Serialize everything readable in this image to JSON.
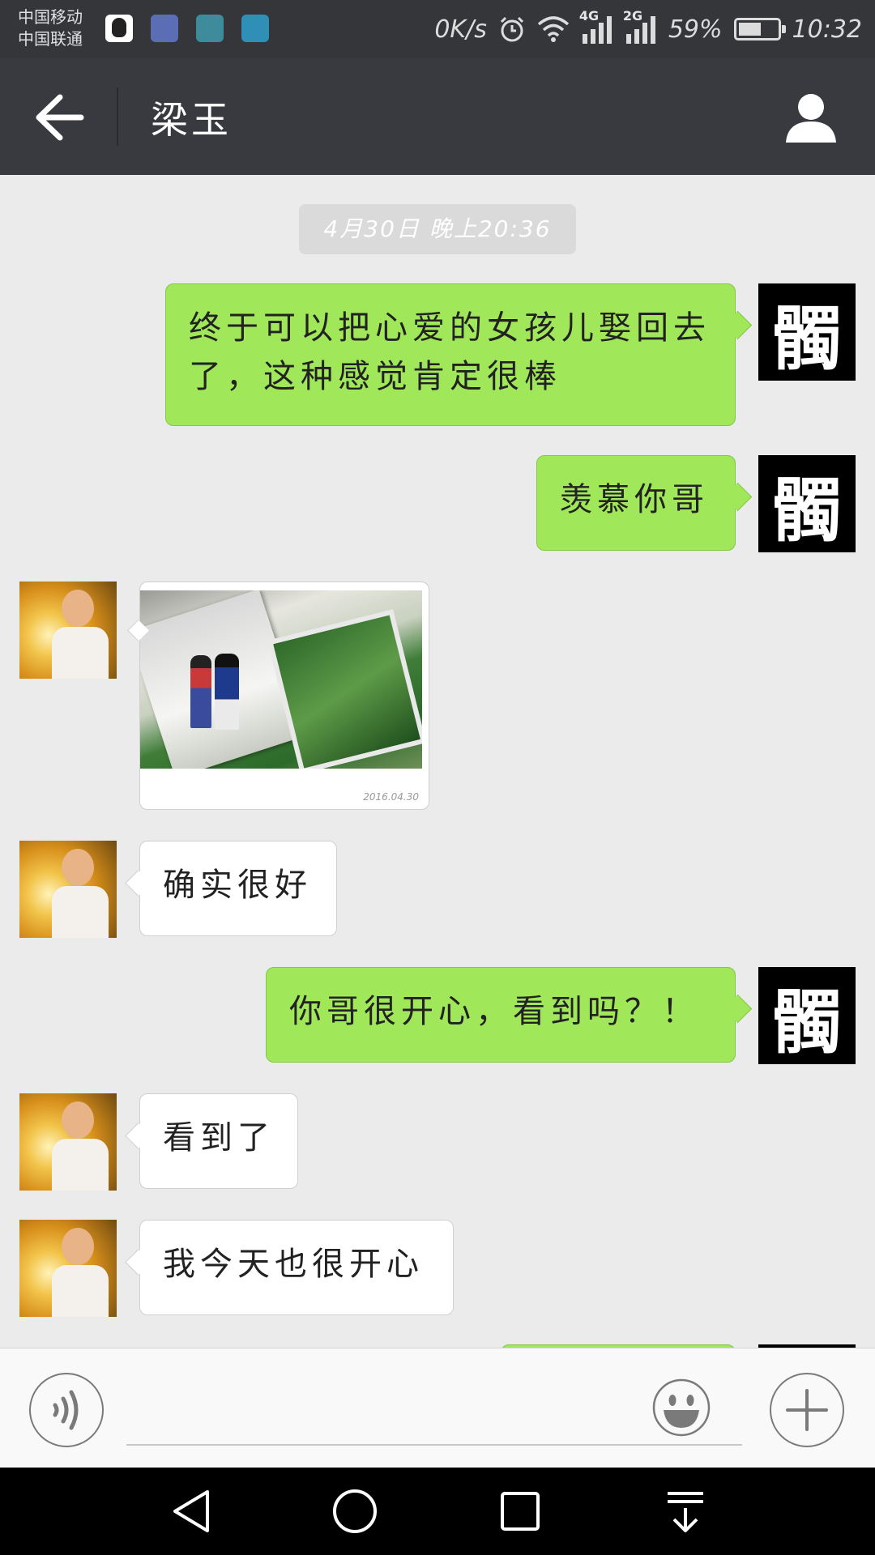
{
  "status_bar": {
    "carrier_1": "中国移动",
    "carrier_2": "中国联通",
    "notification_icons": [
      "qq-icon",
      "health-icon",
      "gallery-icon",
      "message-icon"
    ],
    "network_speed": "0K/s",
    "network_1": "4G",
    "network_2": "2G",
    "battery_percent": "59%",
    "battery_level": 0.59,
    "time": "10:32"
  },
  "header": {
    "title": "梁玉",
    "back_icon": "arrow-left-icon",
    "profile_icon": "person-icon"
  },
  "chat": {
    "timestamp": "4月30日 晚上20:36",
    "my_avatar_char": "髑",
    "messages": [
      {
        "from": "me",
        "type": "text",
        "text": "终于可以把心爱的女孩儿娶回去了，这种感觉肯定很棒"
      },
      {
        "from": "me",
        "type": "text",
        "text": "羡慕你哥"
      },
      {
        "from": "her",
        "type": "image",
        "stamp": "2016.04.30"
      },
      {
        "from": "her",
        "type": "text",
        "text": "确实很好"
      },
      {
        "from": "me",
        "type": "text",
        "text": "你哥很开心，看到吗？！"
      },
      {
        "from": "her",
        "type": "text",
        "text": "看到了"
      },
      {
        "from": "her",
        "type": "text",
        "text": "我今天也很开心"
      }
    ]
  },
  "input_bar": {
    "voice_icon": "voice-icon",
    "emoji_icon": "smiley-icon",
    "plus_icon": "plus-icon",
    "input_value": ""
  },
  "nav_bar": {
    "icons": [
      "back-triangle-icon",
      "home-circle-icon",
      "recents-square-icon",
      "notification-pull-icon"
    ]
  },
  "colors": {
    "status_bar_bg": "#35363a",
    "title_bar_bg": "#393a3f",
    "chat_bg": "#ebebeb",
    "outgoing_bubble": "#a0e75a",
    "incoming_bubble": "#ffffff"
  }
}
